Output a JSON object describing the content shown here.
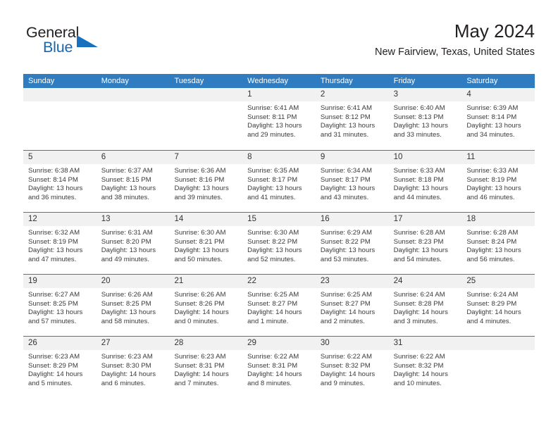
{
  "brand": {
    "name_top": "General",
    "name_bottom": "Blue"
  },
  "header": {
    "title": "May 2024",
    "subtitle": "New Fairview, Texas, United States"
  },
  "colors": {
    "header_blue": "#2f7dc0",
    "brand_blue": "#1667b3",
    "day_band_gray": "#f1f1f1",
    "text": "#231f20"
  },
  "weekdays": [
    "Sunday",
    "Monday",
    "Tuesday",
    "Wednesday",
    "Thursday",
    "Friday",
    "Saturday"
  ],
  "labels": {
    "sunrise_prefix": "Sunrise: ",
    "sunset_prefix": "Sunset: ",
    "daylight_prefix": "Daylight: "
  },
  "weeks": [
    [
      {
        "day": "",
        "sunrise": "",
        "sunset": "",
        "daylight_1": "",
        "daylight_2": ""
      },
      {
        "day": "",
        "sunrise": "",
        "sunset": "",
        "daylight_1": "",
        "daylight_2": ""
      },
      {
        "day": "",
        "sunrise": "",
        "sunset": "",
        "daylight_1": "",
        "daylight_2": ""
      },
      {
        "day": "1",
        "sunrise": "Sunrise: 6:41 AM",
        "sunset": "Sunset: 8:11 PM",
        "daylight_1": "Daylight: 13 hours",
        "daylight_2": "and 29 minutes."
      },
      {
        "day": "2",
        "sunrise": "Sunrise: 6:41 AM",
        "sunset": "Sunset: 8:12 PM",
        "daylight_1": "Daylight: 13 hours",
        "daylight_2": "and 31 minutes."
      },
      {
        "day": "3",
        "sunrise": "Sunrise: 6:40 AM",
        "sunset": "Sunset: 8:13 PM",
        "daylight_1": "Daylight: 13 hours",
        "daylight_2": "and 33 minutes."
      },
      {
        "day": "4",
        "sunrise": "Sunrise: 6:39 AM",
        "sunset": "Sunset: 8:14 PM",
        "daylight_1": "Daylight: 13 hours",
        "daylight_2": "and 34 minutes."
      }
    ],
    [
      {
        "day": "5",
        "sunrise": "Sunrise: 6:38 AM",
        "sunset": "Sunset: 8:14 PM",
        "daylight_1": "Daylight: 13 hours",
        "daylight_2": "and 36 minutes."
      },
      {
        "day": "6",
        "sunrise": "Sunrise: 6:37 AM",
        "sunset": "Sunset: 8:15 PM",
        "daylight_1": "Daylight: 13 hours",
        "daylight_2": "and 38 minutes."
      },
      {
        "day": "7",
        "sunrise": "Sunrise: 6:36 AM",
        "sunset": "Sunset: 8:16 PM",
        "daylight_1": "Daylight: 13 hours",
        "daylight_2": "and 39 minutes."
      },
      {
        "day": "8",
        "sunrise": "Sunrise: 6:35 AM",
        "sunset": "Sunset: 8:17 PM",
        "daylight_1": "Daylight: 13 hours",
        "daylight_2": "and 41 minutes."
      },
      {
        "day": "9",
        "sunrise": "Sunrise: 6:34 AM",
        "sunset": "Sunset: 8:17 PM",
        "daylight_1": "Daylight: 13 hours",
        "daylight_2": "and 43 minutes."
      },
      {
        "day": "10",
        "sunrise": "Sunrise: 6:33 AM",
        "sunset": "Sunset: 8:18 PM",
        "daylight_1": "Daylight: 13 hours",
        "daylight_2": "and 44 minutes."
      },
      {
        "day": "11",
        "sunrise": "Sunrise: 6:33 AM",
        "sunset": "Sunset: 8:19 PM",
        "daylight_1": "Daylight: 13 hours",
        "daylight_2": "and 46 minutes."
      }
    ],
    [
      {
        "day": "12",
        "sunrise": "Sunrise: 6:32 AM",
        "sunset": "Sunset: 8:19 PM",
        "daylight_1": "Daylight: 13 hours",
        "daylight_2": "and 47 minutes."
      },
      {
        "day": "13",
        "sunrise": "Sunrise: 6:31 AM",
        "sunset": "Sunset: 8:20 PM",
        "daylight_1": "Daylight: 13 hours",
        "daylight_2": "and 49 minutes."
      },
      {
        "day": "14",
        "sunrise": "Sunrise: 6:30 AM",
        "sunset": "Sunset: 8:21 PM",
        "daylight_1": "Daylight: 13 hours",
        "daylight_2": "and 50 minutes."
      },
      {
        "day": "15",
        "sunrise": "Sunrise: 6:30 AM",
        "sunset": "Sunset: 8:22 PM",
        "daylight_1": "Daylight: 13 hours",
        "daylight_2": "and 52 minutes."
      },
      {
        "day": "16",
        "sunrise": "Sunrise: 6:29 AM",
        "sunset": "Sunset: 8:22 PM",
        "daylight_1": "Daylight: 13 hours",
        "daylight_2": "and 53 minutes."
      },
      {
        "day": "17",
        "sunrise": "Sunrise: 6:28 AM",
        "sunset": "Sunset: 8:23 PM",
        "daylight_1": "Daylight: 13 hours",
        "daylight_2": "and 54 minutes."
      },
      {
        "day": "18",
        "sunrise": "Sunrise: 6:28 AM",
        "sunset": "Sunset: 8:24 PM",
        "daylight_1": "Daylight: 13 hours",
        "daylight_2": "and 56 minutes."
      }
    ],
    [
      {
        "day": "19",
        "sunrise": "Sunrise: 6:27 AM",
        "sunset": "Sunset: 8:25 PM",
        "daylight_1": "Daylight: 13 hours",
        "daylight_2": "and 57 minutes."
      },
      {
        "day": "20",
        "sunrise": "Sunrise: 6:26 AM",
        "sunset": "Sunset: 8:25 PM",
        "daylight_1": "Daylight: 13 hours",
        "daylight_2": "and 58 minutes."
      },
      {
        "day": "21",
        "sunrise": "Sunrise: 6:26 AM",
        "sunset": "Sunset: 8:26 PM",
        "daylight_1": "Daylight: 14 hours",
        "daylight_2": "and 0 minutes."
      },
      {
        "day": "22",
        "sunrise": "Sunrise: 6:25 AM",
        "sunset": "Sunset: 8:27 PM",
        "daylight_1": "Daylight: 14 hours",
        "daylight_2": "and 1 minute."
      },
      {
        "day": "23",
        "sunrise": "Sunrise: 6:25 AM",
        "sunset": "Sunset: 8:27 PM",
        "daylight_1": "Daylight: 14 hours",
        "daylight_2": "and 2 minutes."
      },
      {
        "day": "24",
        "sunrise": "Sunrise: 6:24 AM",
        "sunset": "Sunset: 8:28 PM",
        "daylight_1": "Daylight: 14 hours",
        "daylight_2": "and 3 minutes."
      },
      {
        "day": "25",
        "sunrise": "Sunrise: 6:24 AM",
        "sunset": "Sunset: 8:29 PM",
        "daylight_1": "Daylight: 14 hours",
        "daylight_2": "and 4 minutes."
      }
    ],
    [
      {
        "day": "26",
        "sunrise": "Sunrise: 6:23 AM",
        "sunset": "Sunset: 8:29 PM",
        "daylight_1": "Daylight: 14 hours",
        "daylight_2": "and 5 minutes."
      },
      {
        "day": "27",
        "sunrise": "Sunrise: 6:23 AM",
        "sunset": "Sunset: 8:30 PM",
        "daylight_1": "Daylight: 14 hours",
        "daylight_2": "and 6 minutes."
      },
      {
        "day": "28",
        "sunrise": "Sunrise: 6:23 AM",
        "sunset": "Sunset: 8:31 PM",
        "daylight_1": "Daylight: 14 hours",
        "daylight_2": "and 7 minutes."
      },
      {
        "day": "29",
        "sunrise": "Sunrise: 6:22 AM",
        "sunset": "Sunset: 8:31 PM",
        "daylight_1": "Daylight: 14 hours",
        "daylight_2": "and 8 minutes."
      },
      {
        "day": "30",
        "sunrise": "Sunrise: 6:22 AM",
        "sunset": "Sunset: 8:32 PM",
        "daylight_1": "Daylight: 14 hours",
        "daylight_2": "and 9 minutes."
      },
      {
        "day": "31",
        "sunrise": "Sunrise: 6:22 AM",
        "sunset": "Sunset: 8:32 PM",
        "daylight_1": "Daylight: 14 hours",
        "daylight_2": "and 10 minutes."
      },
      {
        "day": "",
        "sunrise": "",
        "sunset": "",
        "daylight_1": "",
        "daylight_2": ""
      }
    ]
  ]
}
